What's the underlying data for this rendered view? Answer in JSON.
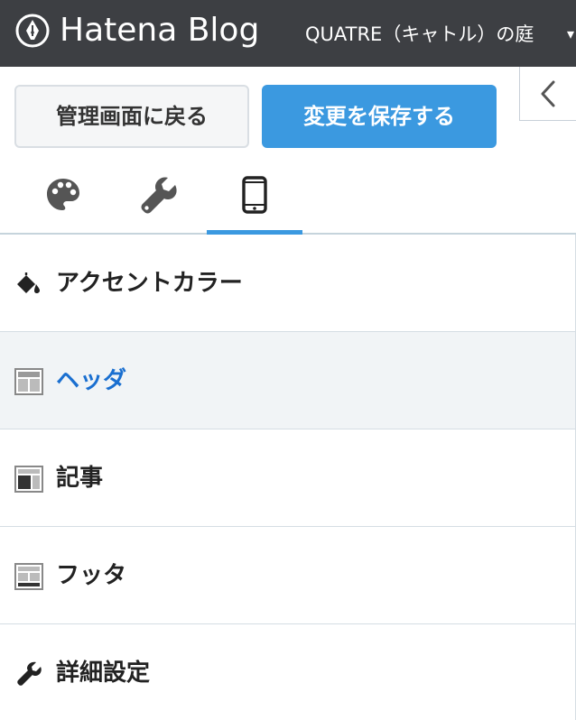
{
  "topbar": {
    "logo_text": "Hatena Blog",
    "blog_title": "QUATRE（キャトル）の庭",
    "caret": "▾"
  },
  "actions": {
    "back_label": "管理画面に戻る",
    "save_label": "変更を保存する"
  },
  "tabs": [
    {
      "name": "design",
      "icon": "palette-icon",
      "active": false
    },
    {
      "name": "customize",
      "icon": "wrench-icon",
      "active": false
    },
    {
      "name": "smartphone",
      "icon": "smartphone-icon",
      "active": true
    }
  ],
  "menu": {
    "items": [
      {
        "label": "アクセントカラー",
        "icon": "paint-bucket-icon"
      },
      {
        "label": "ヘッダ",
        "icon": "layout-header-icon",
        "active": true
      },
      {
        "label": "記事",
        "icon": "layout-article-icon"
      },
      {
        "label": "フッタ",
        "icon": "layout-footer-icon"
      },
      {
        "label": "詳細設定",
        "icon": "wrench-icon"
      }
    ]
  },
  "colors": {
    "topbar_bg": "#3d3f43",
    "accent_blue": "#3b99e0",
    "active_label": "#1a6fd0"
  }
}
